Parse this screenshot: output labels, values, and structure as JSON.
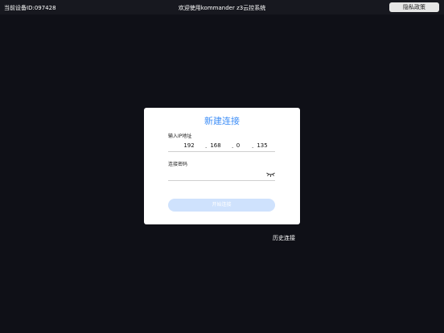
{
  "topbar": {
    "device_id": "当前设备ID:097428",
    "title": "欢迎使用kommander z3云控系统",
    "privacy_label": "隐私政策"
  },
  "dialog": {
    "title": "新建连接",
    "ip_label": "输入IP地址",
    "ip_segments": [
      "192",
      "168",
      "0",
      "135"
    ],
    "ip_separator": ".",
    "password_label": "连接密码",
    "password_value": "",
    "connect_label": "开始连接"
  },
  "history_label": "历史连接",
  "colors": {
    "background": "#0f1017",
    "topbar": "#17181f",
    "accent": "#3d8ef7",
    "button_disabled": "#cfe2fd"
  }
}
